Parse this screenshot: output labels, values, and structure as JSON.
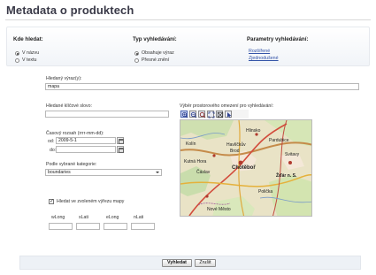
{
  "page": {
    "title": "Metadata o produktech"
  },
  "search_where": {
    "heading": "Kde hledat:",
    "options": [
      {
        "label": "V názvu",
        "selected": true
      },
      {
        "label": "V textu",
        "selected": false
      }
    ]
  },
  "search_type": {
    "heading": "Typ vyhledávání:",
    "options": [
      {
        "label": "Obsahuje výraz",
        "selected": true
      },
      {
        "label": "Přesné znění",
        "selected": false
      }
    ]
  },
  "search_params": {
    "heading": "Parametry vyhledávání:",
    "links": [
      "Rozšířené",
      "Zjednodušené"
    ]
  },
  "phrase": {
    "label": "Hledaný výraz(y):",
    "value": "mapa"
  },
  "keyword": {
    "label": "Hledané klíčové slovo:",
    "value": ""
  },
  "time_range": {
    "label": "Časový rozsah (rrrr-mm-dd):",
    "from_label": "od:",
    "from_value": "2009-5-1",
    "to_label": "do:",
    "to_value": ""
  },
  "category": {
    "label": "Podle vybrané kategorie:",
    "selected": "boundaries"
  },
  "map_extent": {
    "label": "Výběr prostorového omezení pro vyhledávání:"
  },
  "map_tools": [
    "zoom-in-icon",
    "zoom-out-icon",
    "pan-icon",
    "full-extent-icon",
    "select-box-icon",
    "pointer-icon"
  ],
  "map_labels": [
    "Hlinsko",
    "Havlíčkův",
    "Brod",
    "Chotěboř",
    "Kolín",
    "Kutná Hora",
    "Čáslav",
    "Pardubice",
    "Svitavy",
    "Žďár n. S.",
    "Polička",
    "Nové Město"
  ],
  "current_extent": {
    "label": "Hledat ve zvoleném výřezu mapy",
    "checked": true
  },
  "coords": [
    {
      "label": "wLong",
      "value": ""
    },
    {
      "label": "sLati",
      "value": ""
    },
    {
      "label": "eLong",
      "value": ""
    },
    {
      "label": "nLati",
      "value": ""
    }
  ],
  "actions": {
    "search": "Vyhledat",
    "clear": "Zrušit"
  },
  "colors": {
    "title": "#3a3a48",
    "link": "#3454a8",
    "panel": "#f1f4f8"
  }
}
